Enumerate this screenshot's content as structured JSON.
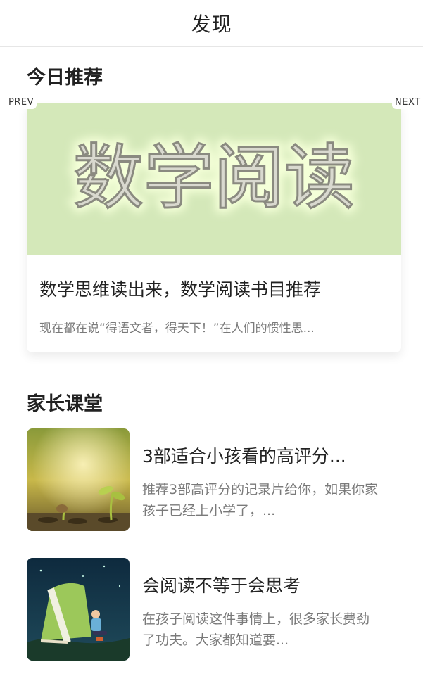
{
  "navbar": {
    "title": "发现"
  },
  "today": {
    "section_title": "今日推荐",
    "prev_label": "PREV",
    "next_label": "NEXT",
    "banner_text": "数学阅读",
    "card_title": "数学思维读出来，数学阅读书目推荐",
    "card_summary": "现在都在说“得语文者，得天下！”在人们的惯性思..."
  },
  "parents": {
    "section_title": "家长课堂",
    "items": [
      {
        "title": "3部适合小孩看的高评分...",
        "summary": "推荐3部高评分的记录片给你，如果你家孩子已经上小学了，..."
      },
      {
        "title": "会阅读不等于会思考",
        "summary": "在孩子阅读这件事情上，很多家长费劲了功夫。大家都知道要..."
      }
    ]
  },
  "colors": {
    "banner_bg": "#d4e8b9",
    "text_primary": "#222222",
    "text_secondary": "#7a7a7a"
  }
}
